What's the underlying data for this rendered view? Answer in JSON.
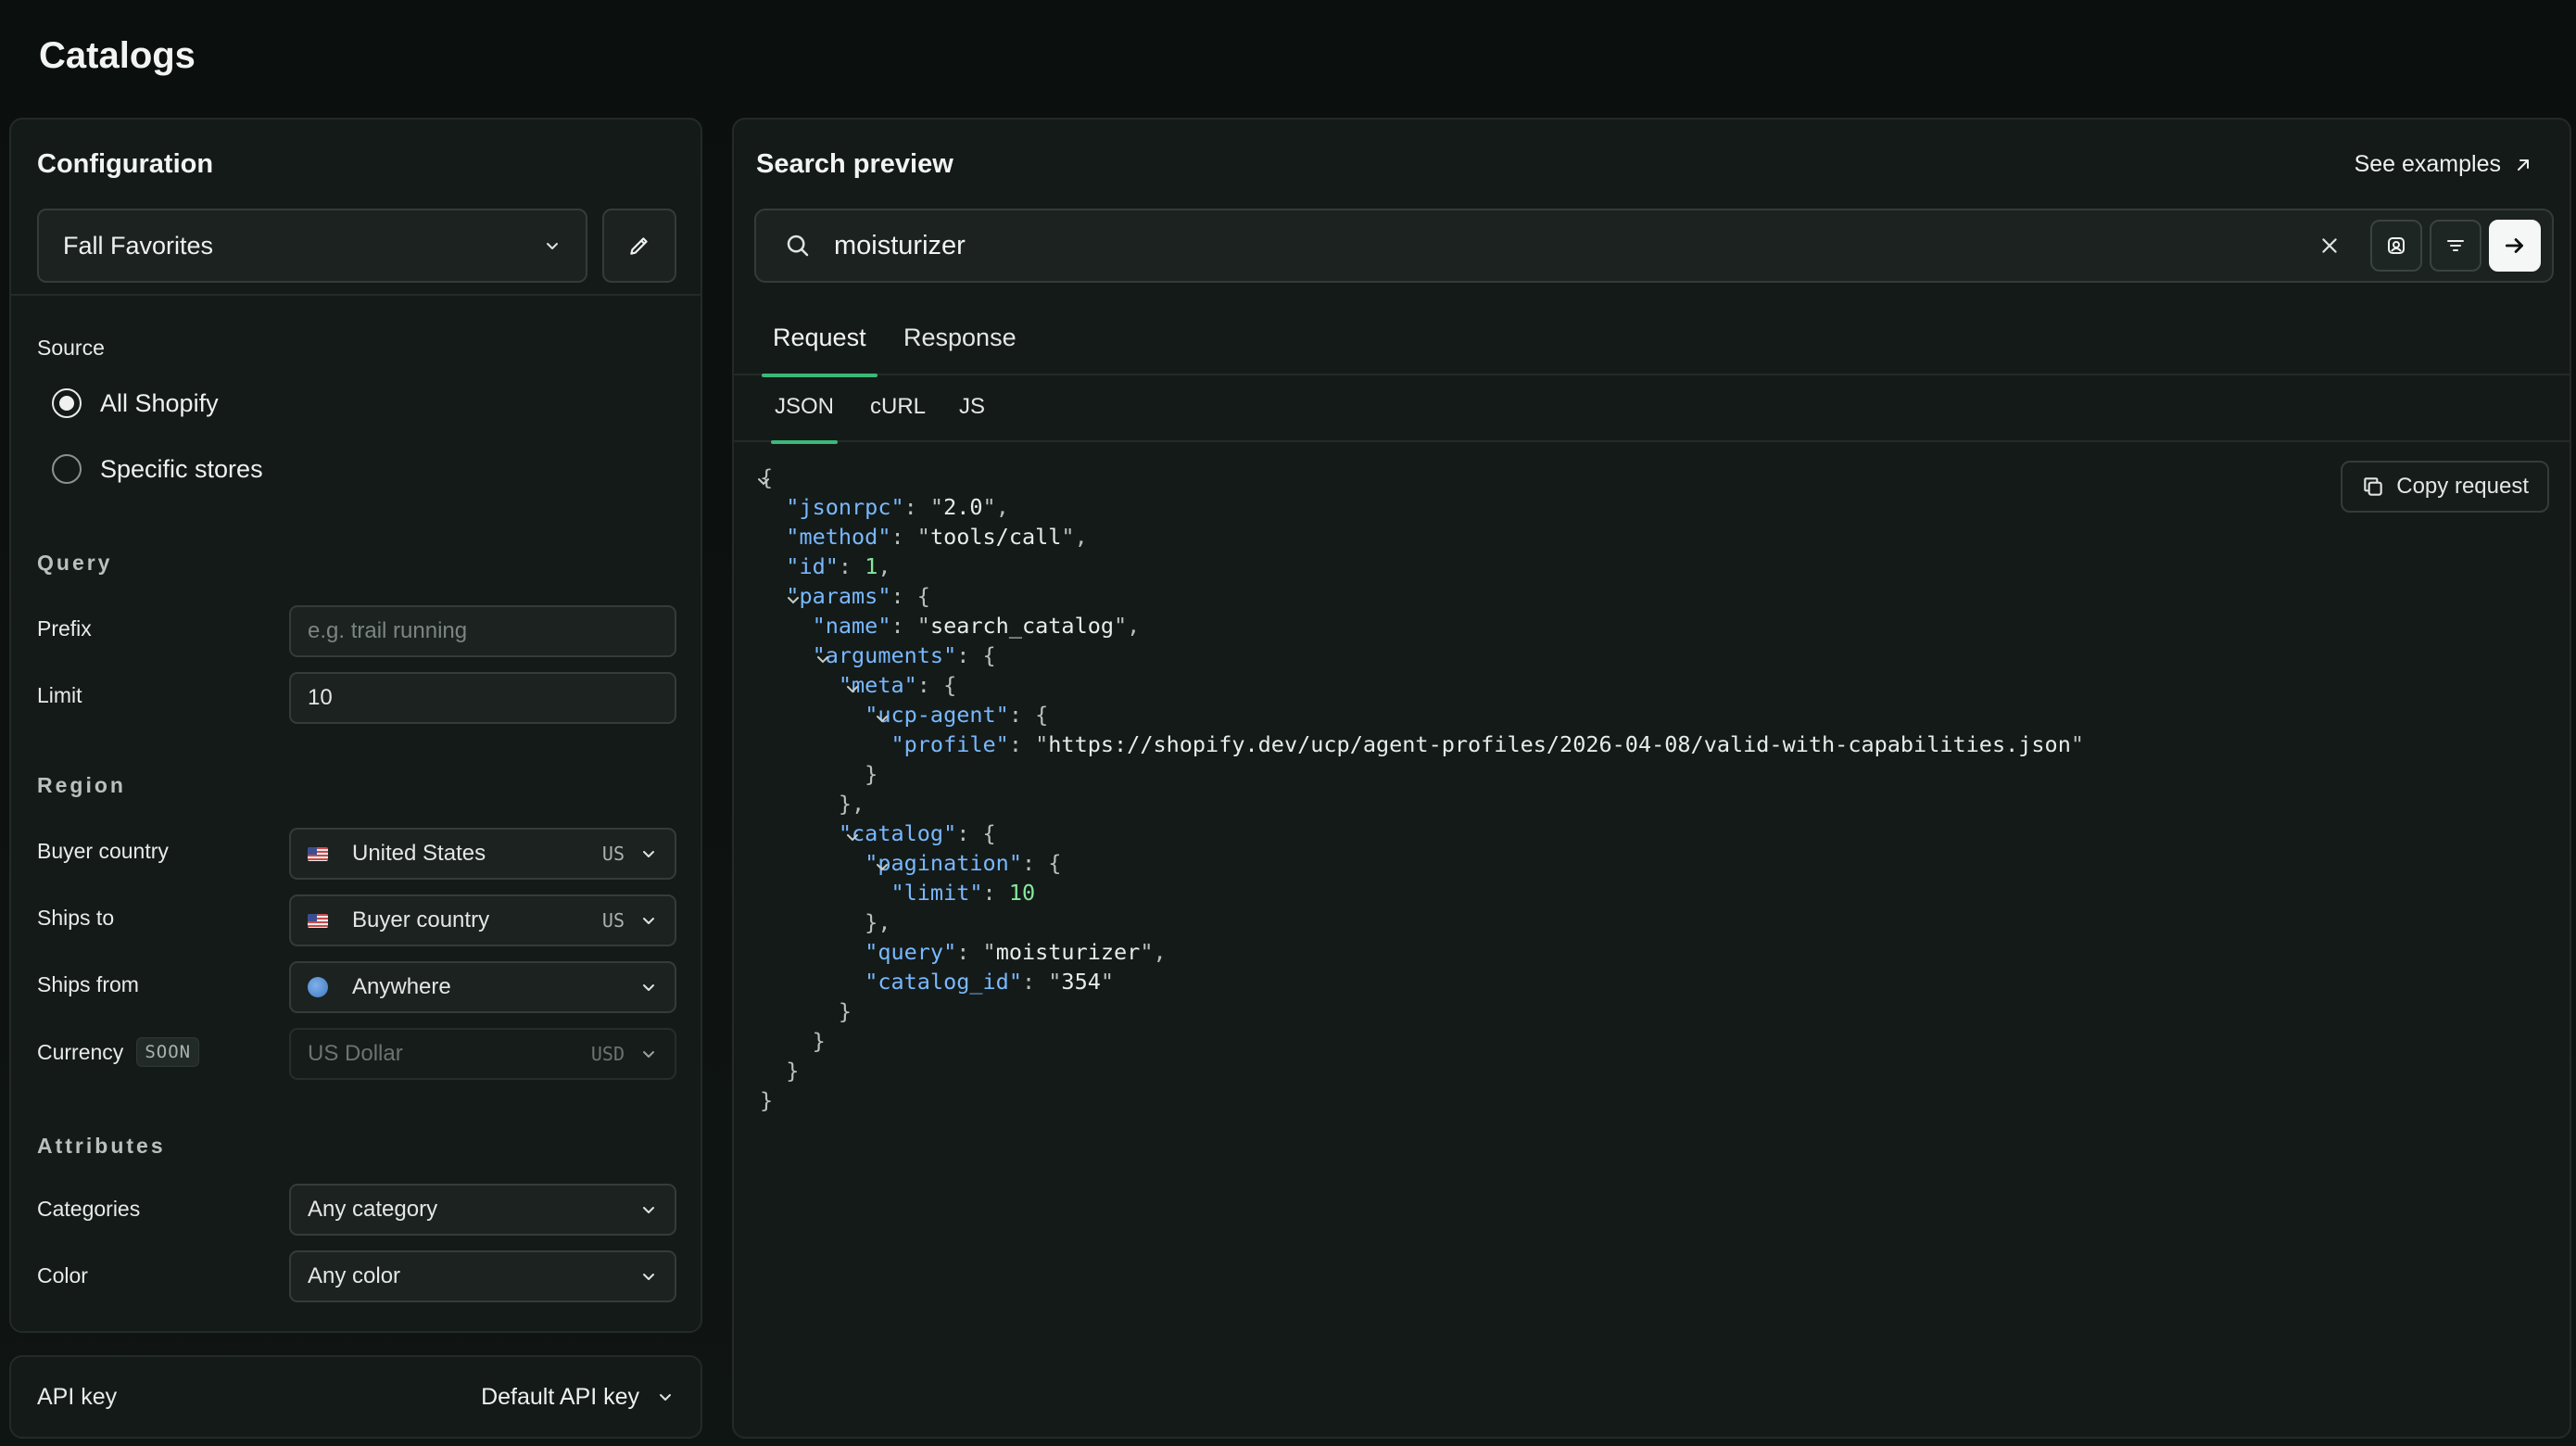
{
  "page": {
    "title": "Catalogs"
  },
  "config": {
    "title": "Configuration",
    "catalog_select": "Fall Favorites",
    "source": {
      "label": "Source",
      "options": [
        {
          "label": "All Shopify",
          "checked": true
        },
        {
          "label": "Specific stores",
          "checked": false
        }
      ]
    },
    "query": {
      "heading": "Query",
      "prefix_label": "Prefix",
      "prefix_placeholder": "e.g. trail running",
      "limit_label": "Limit",
      "limit_value": "10"
    },
    "region": {
      "heading": "Region",
      "buyer_country_label": "Buyer country",
      "buyer_country_value": "United States",
      "buyer_country_code": "US",
      "ships_to_label": "Ships to",
      "ships_to_value": "Buyer country",
      "ships_to_code": "US",
      "ships_from_label": "Ships from",
      "ships_from_value": "Anywhere",
      "currency_label": "Currency",
      "currency_badge": "SOON",
      "currency_value": "US Dollar",
      "currency_code": "USD"
    },
    "attributes": {
      "heading": "Attributes",
      "categories_label": "Categories",
      "categories_value": "Any category",
      "color_label": "Color",
      "color_value": "Any color"
    }
  },
  "api_key": {
    "label": "API key",
    "value": "Default API key"
  },
  "preview": {
    "title": "Search preview",
    "see_examples": "See examples",
    "search_query": "moisturizer",
    "tabs": [
      "Request",
      "Response"
    ],
    "subtabs": [
      "JSON",
      "cURL",
      "JS"
    ],
    "copy_label": "Copy request",
    "accent_color": "#3bb97a"
  },
  "request_json": {
    "jsonrpc": "2.0",
    "method": "tools/call",
    "id": "1",
    "name": "search_catalog",
    "profile": "https://shopify.dev/ucp/agent-profiles/2026-04-08/valid-with-capabilities.json",
    "limit": "10",
    "query": "moisturizer",
    "catalog_id": "354"
  }
}
